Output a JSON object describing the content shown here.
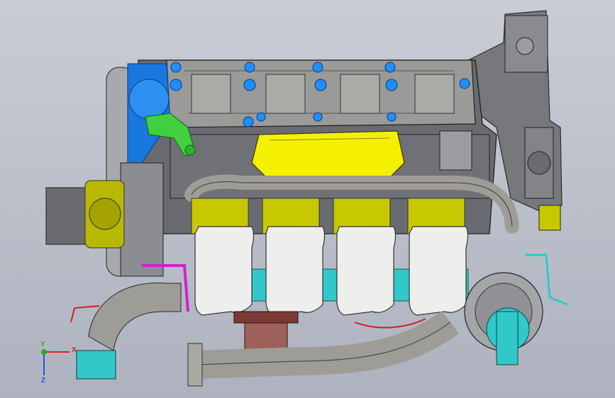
{
  "triad": {
    "x_label": "X",
    "y_label": "Y",
    "z_label": "Z",
    "colors": {
      "x": "#e02020",
      "y": "#20b020",
      "z": "#3050d0"
    }
  },
  "colors": {
    "background_top": "#c9ccd4",
    "background_bottom": "#aeb2bf",
    "block": "#6a6b70",
    "manifold": "#9a9a98",
    "pipe": "#9d9c96",
    "valve_cover": "#f5f000",
    "plug_blue": "#1e8fff",
    "flywheel_blue": "#1878e0",
    "bracket_yellow": "#c8c800",
    "cyan_part": "#30c8c8",
    "green_fitting": "#40d040",
    "dark_red": "#a0605a",
    "magenta_hose": "#d020d0"
  }
}
